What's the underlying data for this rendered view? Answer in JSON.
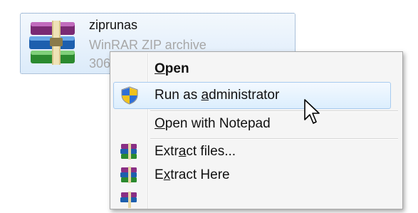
{
  "file": {
    "name": "ziprunas",
    "type": "WinRAR ZIP archive",
    "size": "306",
    "icon": "winrar-archive-icon"
  },
  "menu": {
    "open": {
      "pre": "",
      "key": "O",
      "post": "pen"
    },
    "run_as_admin": {
      "pre": "Run as ",
      "key": "a",
      "post": "dministrator",
      "icon": "uac-shield-icon"
    },
    "open_notepad": {
      "pre": "",
      "key": "O",
      "post": "pen with Notepad"
    },
    "extract_files": {
      "pre": "Extr",
      "key": "a",
      "post": "ct files...",
      "icon": "winrar-archive-icon"
    },
    "extract_here": {
      "pre": "E",
      "key": "x",
      "post": "tract Here",
      "icon": "winrar-archive-icon"
    },
    "partial_item": {
      "icon": "winrar-archive-icon"
    }
  },
  "colors": {
    "hover_border": "#a8cbef",
    "selection_border": "#6b8fb8"
  }
}
